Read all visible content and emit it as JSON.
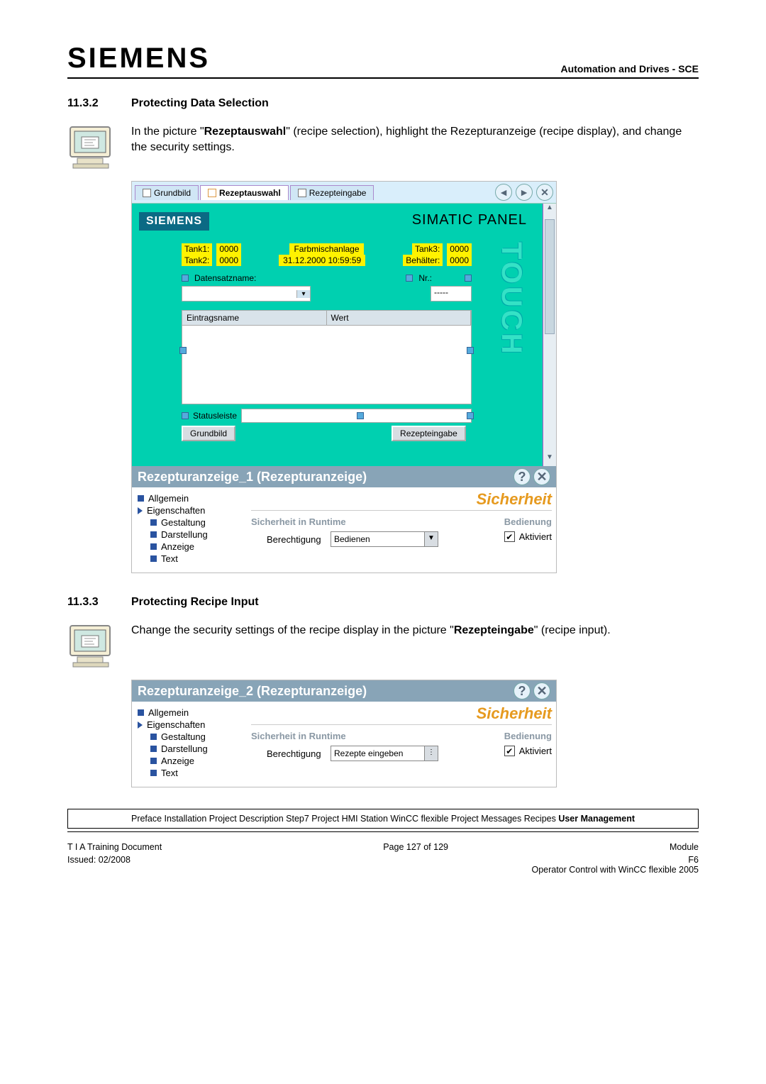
{
  "header": {
    "logo": "SIEMENS",
    "right": "Automation and Drives - SCE"
  },
  "sec1": {
    "num": "11.3.2",
    "title": "Protecting Data Selection",
    "para_a": "In the picture \"",
    "para_b": "Rezeptauswahl",
    "para_c": "\" (recipe selection), highlight the Rezepturanzeige (recipe display), and change the security settings."
  },
  "shot1": {
    "tabs": {
      "t1": "Grundbild",
      "t2": "Rezeptauswahl",
      "t3": "Rezepteingabe"
    },
    "nav": {
      "back": "◄",
      "fwd": "►",
      "close": "✕"
    },
    "panel": {
      "brand": "SIEMENS",
      "simatic": "SIMATIC PANEL",
      "touch": "TOUCH",
      "tank1_l": "Tank1:",
      "tank1_v": "0000",
      "tank2_l": "Tank2:",
      "tank2_v": "0000",
      "tank3_l": "Tank3:",
      "tank3_v": "0000",
      "beh_l": "Behälter:",
      "beh_v": "0000",
      "fmix": "Farbmischanlage",
      "ts": "31.12.2000 10:59:59",
      "ds_label": "Datensatzname:",
      "nr_label": "Nr.:",
      "nr_val": "-----",
      "col1": "Eintragsname",
      "col2": "Wert",
      "status": "Statusleiste",
      "btn1": "Grundbild",
      "btn2": "Rezepteingabe"
    },
    "prop": {
      "title": "Rezepturanzeige_1 (Rezepturanzeige)",
      "p1": "Allgemein",
      "p2": "Eigenschaften",
      "p3": "Gestaltung",
      "p4": "Darstellung",
      "p5": "Anzeige",
      "p6": "Text",
      "sich": "Sicherheit",
      "runtime_hd": "Sicherheit in Runtime",
      "perm_lbl": "Berechtigung",
      "perm_val": "Bedienen",
      "bed_hd": "Bedienung",
      "akt": "Aktiviert"
    }
  },
  "sec2": {
    "num": "11.3.3",
    "title": "Protecting Recipe Input",
    "para_a": "Change the security settings of the recipe display in the picture \"",
    "para_b": "Rezepteingabe",
    "para_c": "\" (recipe input)."
  },
  "shot2": {
    "prop": {
      "title": "Rezepturanzeige_2 (Rezepturanzeige)",
      "p1": "Allgemein",
      "p2": "Eigenschaften",
      "p3": "Gestaltung",
      "p4": "Darstellung",
      "p5": "Anzeige",
      "p6": "Text",
      "sich": "Sicherheit",
      "runtime_hd": "Sicherheit in Runtime",
      "perm_lbl": "Berechtigung",
      "perm_val": "Rezepte eingeben",
      "bed_hd": "Bedienung",
      "akt": "Aktiviert"
    }
  },
  "footer": {
    "crumbs_plain": "Preface Installation Project Description Step7 Project HMI Station WinCC flexible Project Messages Recipes ",
    "crumbs_bold": "User Management",
    "left1": "T I A  Training Document",
    "mid1": "Page 127 of 129",
    "right1": "Module",
    "right1b": "F6",
    "left2": "Issued: 02/2008",
    "right2": "Operator Control with WinCC flexible 2005"
  }
}
